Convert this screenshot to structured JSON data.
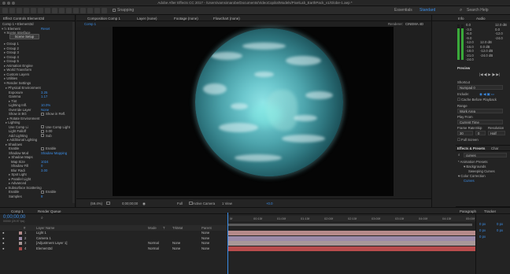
{
  "app": {
    "title": "Adobe After Effects CC 2017 - /Users/vamsimarobe/Documents/VideoCopilot/Models/PixelLab_EarthPack_v1/Globe-1.aep *"
  },
  "toolbar": {
    "snapping_label": "Snapping",
    "workspaces": [
      "Essentials",
      "Standard"
    ],
    "active_workspace": "Standard",
    "search_label": "Search Help"
  },
  "effect_controls": {
    "tab_label": "Effect Controls Element3d",
    "breadcrumb": "Comp 1 • Element3d",
    "effect_name": "Element",
    "reset_label": "Reset",
    "scene_interface": "Scene Interface",
    "scene_setup_label": "Scene Setup",
    "groups": [
      "Group 1",
      "Group 2",
      "Group 3",
      "Group 4",
      "Group 5",
      "Animation Engine",
      "World Transform",
      "Custom Layers",
      "Utilities",
      "Render Settings"
    ],
    "render_rows": [
      {
        "label": "Physical Environment",
        "value": ""
      },
      {
        "label": "Exposure",
        "value": "3.25"
      },
      {
        "label": "Gamma",
        "value": "1.17"
      },
      {
        "label": "Tint",
        "value": ""
      },
      {
        "label": "Lighting Infl.",
        "value": "10.0%"
      },
      {
        "label": "Override Layer",
        "value": "None"
      },
      {
        "label": "Show in BG",
        "value": "Show in Refl."
      },
      {
        "label": "Rotate Environment",
        "value": ""
      },
      {
        "label": "Lighting",
        "value": ""
      },
      {
        "label": "Use Comp Li",
        "value": "Use Comp Light"
      },
      {
        "label": "Light Falloff",
        "value": "0.00"
      },
      {
        "label": "Add Lighting",
        "value": "Sub"
      },
      {
        "label": "Additional Lighting",
        "value": ""
      },
      {
        "label": "Shadows",
        "value": ""
      },
      {
        "label": "Enable",
        "value": "Enable"
      },
      {
        "label": "Shadow Mod",
        "value": "Shadow Mapping"
      },
      {
        "label": "Shadow Maps",
        "value": ""
      },
      {
        "label": "Map Size",
        "value": "1024"
      },
      {
        "label": "Shadow Fill",
        "value": "0"
      },
      {
        "label": "Blur Radi",
        "value": "3.00"
      },
      {
        "label": "Spot Light",
        "value": ""
      },
      {
        "label": "Parallel Light",
        "value": ""
      },
      {
        "label": "Advanced",
        "value": ""
      },
      {
        "label": "Subsurface Scattering",
        "value": ""
      },
      {
        "label": "Enable",
        "value": "Enable"
      },
      {
        "label": "Samples",
        "value": "8"
      }
    ]
  },
  "composition": {
    "tab_label": "Composition Comp 1",
    "layer_tab": "Layer (none)",
    "footage_tab": "Footage (none)",
    "flowchart_tab": "Flowchart (none)",
    "comp_tab_small": "Comp 1",
    "renderer_label": "Renderer:",
    "renderer_value": "CINEMA 4D",
    "zoom": "(59.4%)",
    "timecode": "0;00;00;00",
    "resolution": "Full",
    "camera": "Active Camera",
    "views": "1 View",
    "exposure": "+0.0"
  },
  "right_panel": {
    "info_tab": "Info",
    "audio_tab": "Audio",
    "audio_left": [
      "0.0",
      "-3.0",
      "-6.0",
      "-9.0",
      "-12.0",
      "-15.0",
      "-18.0",
      "-21.0",
      "-24.0"
    ],
    "audio_right": [
      "12.0 dB",
      "0.0 dB",
      "-12.0 dB",
      "-24.0 dB"
    ],
    "audio_db_right": [
      "12.0 dB",
      "0.0",
      "-12.0",
      "-24.0"
    ],
    "preview_title": "Preview",
    "shortcut_label": "Shortcut",
    "shortcut_value": "Numpad 0",
    "include_label": "Include:",
    "cache_label": "Cache Before Playback",
    "range_label": "Range",
    "range_value": "Work Area",
    "play_from_label": "Play From",
    "play_from_value": "Current Time",
    "frame_rate_label": "Frame Rate",
    "skip_label": "Skip",
    "resolution_label": "Resolution",
    "frame_rate_value": "30",
    "skip_value": "0",
    "resolution_value": "Half",
    "full_screen_label": "Full Screen",
    "effects_tab": "Effects & Presets",
    "char_tab": "Char",
    "search_value": "curves",
    "tree": [
      "* Animation Presets",
      "Backgrounds",
      "Sweeping Curves",
      "Color Correction",
      "Curves"
    ],
    "paragraph_tab": "Paragraph",
    "tracker_tab": "Tracker",
    "para_values": [
      "0 px",
      "0 px",
      "0 px",
      "0 px",
      "0 px"
    ]
  },
  "timeline": {
    "tab_label": "Comp 1",
    "render_queue_label": "Render Queue",
    "timecode": "0;00;00;00",
    "fps_label": "00000 (29.97 fps)",
    "columns": [
      "#",
      "Layer Name",
      "Mode",
      "T",
      "TrkMat",
      "Parent"
    ],
    "layers": [
      {
        "num": "1",
        "name": "Light 1",
        "mode": "",
        "trk": "",
        "parent": "None",
        "color": "#b58a8a"
      },
      {
        "num": "2",
        "name": "Camera 1",
        "mode": "",
        "trk": "",
        "parent": "None",
        "color": "#9a8aa8"
      },
      {
        "num": "3",
        "name": "[Adjustment Layer 1]",
        "mode": "Normal",
        "trk": "None",
        "parent": "None",
        "color": "#a89898"
      },
      {
        "num": "4",
        "name": "Element3d",
        "mode": "Normal",
        "trk": "None",
        "parent": "None",
        "color": "#a84a4a"
      }
    ],
    "ruler": [
      "0f",
      "00:15f",
      "01:00f",
      "01:15f",
      "02:00f",
      "02:15f",
      "03:00f",
      "03:15f",
      "04:00f",
      "04:15f",
      "05:00f"
    ]
  },
  "colors": {
    "accent": "#3b8ee8",
    "layer_red": "#b84c4c",
    "layer_pink": "#b89a9a"
  }
}
